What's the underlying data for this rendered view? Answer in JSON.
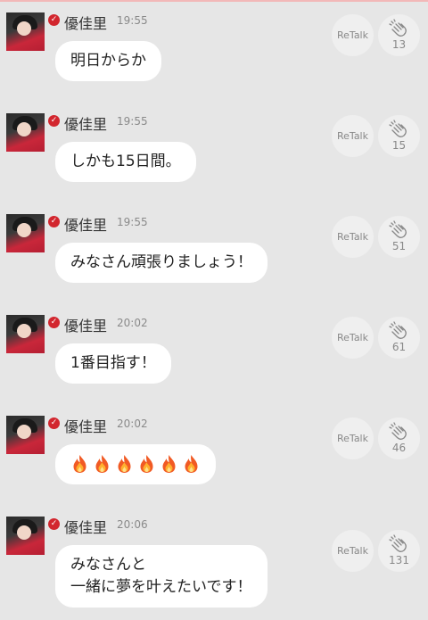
{
  "icons": {
    "verified": "checkmark-icon",
    "clap": "clap-icon",
    "fire": "fire-icon"
  },
  "colors": {
    "background": "#e6e6e6",
    "verified_badge": "#d2262e",
    "bubble": "#ffffff"
  },
  "messages": [
    {
      "user": "優佳里",
      "time": "19:55",
      "text": "明日からか",
      "retalk_label": "ReTalk",
      "clap_count": "13"
    },
    {
      "user": "優佳里",
      "time": "19:55",
      "text": "しかも15日間。",
      "retalk_label": "ReTalk",
      "clap_count": "15"
    },
    {
      "user": "優佳里",
      "time": "19:55",
      "text": "みなさん頑張りましょう！",
      "retalk_label": "ReTalk",
      "clap_count": "51"
    },
    {
      "user": "優佳里",
      "time": "20:02",
      "text": "1番目指す！",
      "retalk_label": "ReTalk",
      "clap_count": "61"
    },
    {
      "user": "優佳里",
      "time": "20:02",
      "emoji": "fire-icon",
      "emoji_count": 6,
      "retalk_label": "ReTalk",
      "clap_count": "46"
    },
    {
      "user": "優佳里",
      "time": "20:06",
      "text": "みなさんと\n一緒に夢を叶えたいです！",
      "retalk_label": "ReTalk",
      "clap_count": "131"
    }
  ]
}
